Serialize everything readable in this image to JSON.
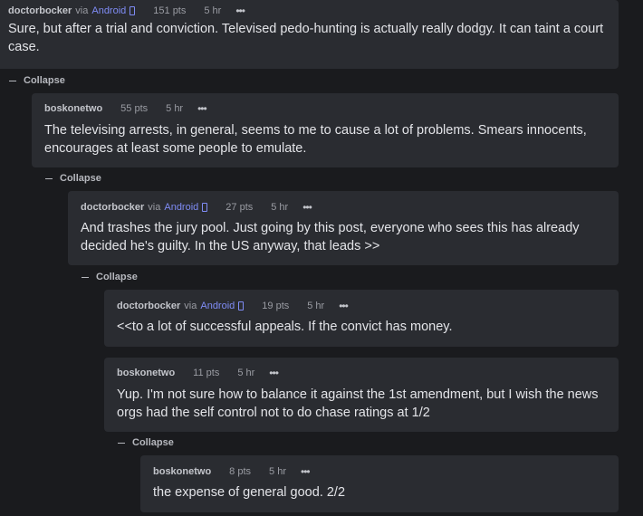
{
  "collapse_label": "Collapse",
  "comments": [
    {
      "author": "doctorbocker",
      "via": "via",
      "client": "Android",
      "points": "151 pts",
      "time": "5 hr",
      "more": "•••",
      "text": "Sure, but after a trial and conviction. Televised pedo-hunting is actually really dodgy. It can taint a court case."
    },
    {
      "author": "boskonetwo",
      "points": "55 pts",
      "time": "5 hr",
      "more": "•••",
      "text": "The televising arrests, in general, seems to me to cause a lot of problems. Smears innocents, encourages at least some people to emulate."
    },
    {
      "author": "doctorbocker",
      "via": "via",
      "client": "Android",
      "points": "27 pts",
      "time": "5 hr",
      "more": "•••",
      "text": "And trashes the jury pool. Just going by this post, everyone who sees this has already decided he's guilty. In the US anyway, that leads >>"
    },
    {
      "author": "doctorbocker",
      "via": "via",
      "client": "Android",
      "points": "19 pts",
      "time": "5 hr",
      "more": "•••",
      "text": "<<to a lot of successful appeals. If the convict has money."
    },
    {
      "author": "boskonetwo",
      "points": "11 pts",
      "time": "5 hr",
      "more": "•••",
      "text": "Yup. I'm not sure how to balance it against the 1st amendment, but I wish the news orgs had the self control not to do chase ratings at 1/2"
    },
    {
      "author": "boskonetwo",
      "points": "8 pts",
      "time": "5 hr",
      "more": "•••",
      "text": "the expense of general good. 2/2"
    }
  ]
}
